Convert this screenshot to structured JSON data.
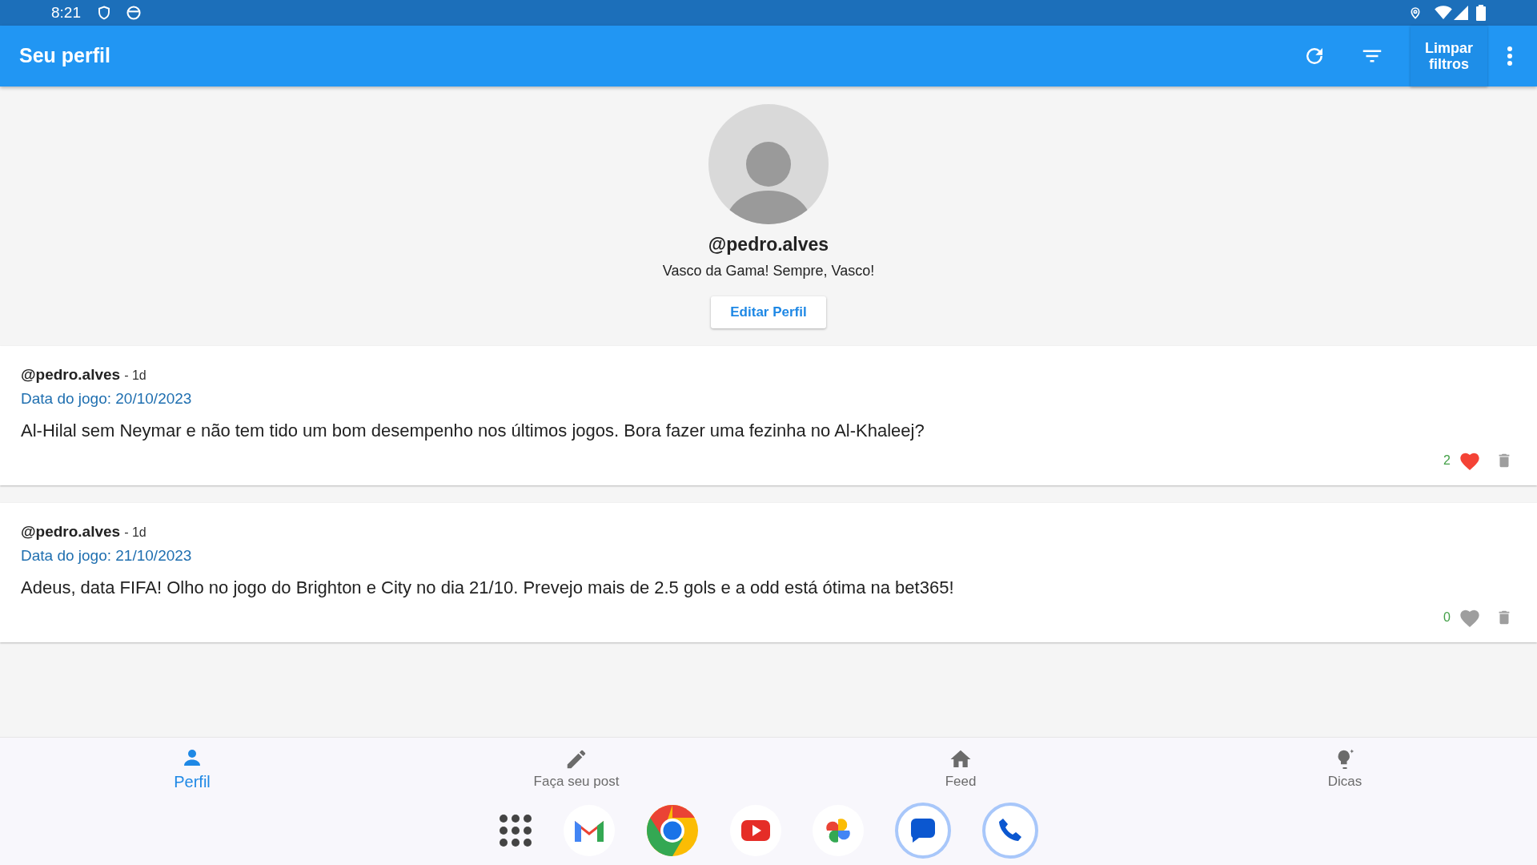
{
  "status_bar": {
    "time": "8:21"
  },
  "app_bar": {
    "title": "Seu perfil",
    "clear_button": "Limpar filtros"
  },
  "profile": {
    "username": "@pedro.alves",
    "bio": "Vasco da Gama! Sempre, Vasco!",
    "edit_button": "Editar Perfil"
  },
  "posts": [
    {
      "author": "@pedro.alves",
      "age": "- 1d",
      "game_date": "Data do jogo: 20/10/2023",
      "text": "Al-Hilal sem Neymar e não tem tido um bom desempenho nos últimos jogos. Bora fazer uma fezinha no Al-Khaleej?",
      "likes": "2",
      "liked": true
    },
    {
      "author": "@pedro.alves",
      "age": "- 1d",
      "game_date": "Data do jogo: 21/10/2023",
      "text": "Adeus, data FIFA! Olho no jogo do Brighton e City no dia 21/10. Prevejo mais de 2.5 gols e a odd está ótima na bet365!",
      "likes": "0",
      "liked": false
    }
  ],
  "bottom_nav": [
    {
      "kind": "person",
      "label": "Perfil",
      "selected": true
    },
    {
      "kind": "pencil",
      "label": "Faça seu post",
      "selected": false
    },
    {
      "kind": "home",
      "label": "Feed",
      "selected": false
    },
    {
      "kind": "bulb",
      "label": "Dicas",
      "selected": false
    }
  ]
}
